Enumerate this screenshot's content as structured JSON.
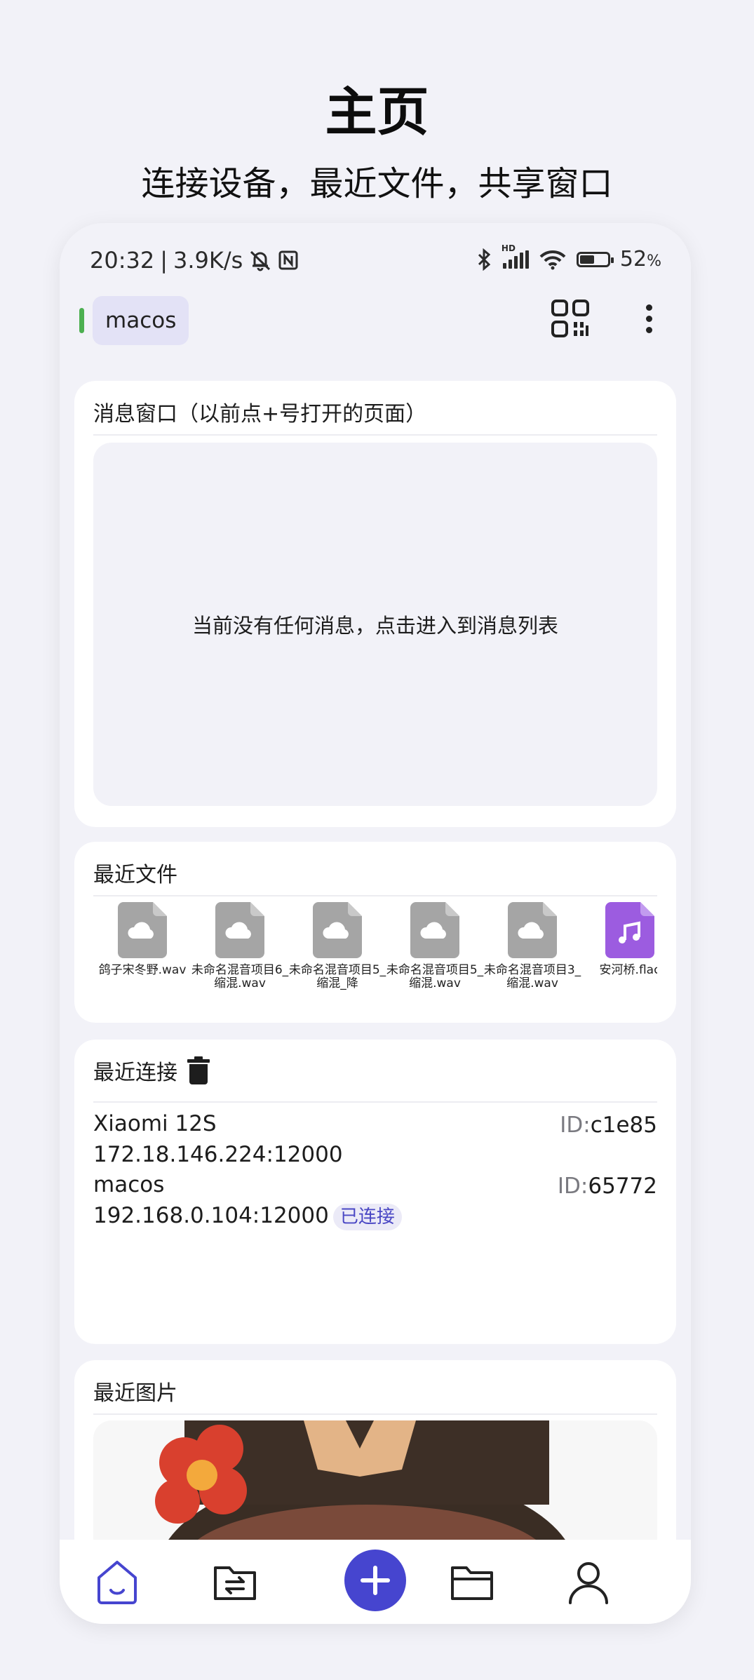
{
  "hero": {
    "title": "主页",
    "subtitle": "连接设备，最近文件，共享窗口"
  },
  "statusbar": {
    "time": "20:32",
    "speed": "3.9K/s",
    "battery_percent": "52",
    "battery_unit": "%",
    "battery_level": 0.52,
    "hd_label": "HD"
  },
  "header": {
    "device_name": "macos",
    "device_status_color": "#4caf50"
  },
  "message_card": {
    "title": "消息窗口（以前点+号打开的页面）",
    "empty_text": "当前没有任何消息，点击进入到消息列表"
  },
  "recent_files": {
    "title": "最近文件",
    "items": [
      {
        "name": "鸽子宋冬野.wav",
        "icon": "cloud-file-icon"
      },
      {
        "name": "未命名混音项目6_缩混.wav",
        "icon": "cloud-file-icon"
      },
      {
        "name": "未命名混音项目5_缩混_降",
        "icon": "cloud-file-icon"
      },
      {
        "name": "未命名混音项目5_缩混.wav",
        "icon": "cloud-file-icon"
      },
      {
        "name": "未命名混音项目3_缩混.wav",
        "icon": "cloud-file-icon"
      },
      {
        "name": "安河桥.flac",
        "icon": "music-file-icon"
      }
    ]
  },
  "recent_connections": {
    "title": "最近连接",
    "id_label": "ID:",
    "items": [
      {
        "name": "Xiaomi 12S",
        "id": "c1e85",
        "address": "172.18.146.224:12000",
        "badge": ""
      },
      {
        "name": "macos",
        "id": "65772",
        "address": "192.168.0.104:12000",
        "badge": "已连接"
      }
    ]
  },
  "recent_images": {
    "title": "最近图片"
  },
  "colors": {
    "accent": "#4645cf",
    "music": "#9c5ce0",
    "file_gray": "#a5a5a5"
  },
  "nav": [
    {
      "name": "home",
      "icon": "home-icon"
    },
    {
      "name": "transfer",
      "icon": "folder-transfer-icon"
    },
    {
      "name": "add",
      "icon": "plus-icon"
    },
    {
      "name": "files",
      "icon": "folder-icon"
    },
    {
      "name": "profile",
      "icon": "user-icon"
    }
  ]
}
